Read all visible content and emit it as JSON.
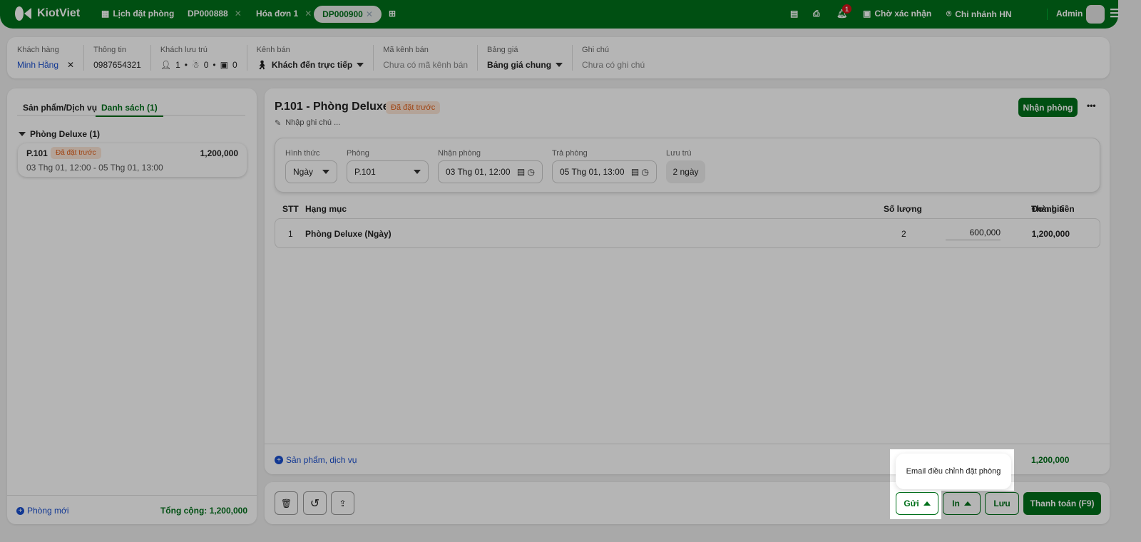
{
  "header": {
    "brand": "KiotViet",
    "nav_calendar": "Lịch đặt phòng",
    "tabs": [
      {
        "label": "DP000888"
      },
      {
        "label": "Hóa đơn 1"
      },
      {
        "label": "DP000900"
      }
    ],
    "notification_count": "1",
    "pending": "Chờ xác nhận",
    "branch": "Chi nhánh HN",
    "user": "Admin"
  },
  "customer_bar": {
    "customer_label": "Khách hàng",
    "customer": "Minh Hằng",
    "info_label": "Thông tin",
    "phone": "0987654321",
    "guests_label": "Khách lưu trú",
    "adults": "1",
    "children": "0",
    "ids": "0",
    "channel_label": "Kênh bán",
    "channel": "Khách đến trực tiếp",
    "channel_code_label": "Mã kênh bán",
    "channel_code_placeholder": "Chưa có mã kênh bán",
    "pricebook_label": "Bảng giá",
    "pricebook": "Bảng giá chung",
    "note_label": "Ghi chú",
    "note_placeholder": "Chưa có ghi chú"
  },
  "left": {
    "tabs": [
      "Sản phẩm/Dịch vụ",
      "Danh sách (1)"
    ],
    "group": "Phòng Deluxe (1)",
    "room": {
      "name": "P.101",
      "status": "Đã đặt trước",
      "price": "1,200,000",
      "dates": "03 Thg 01, 12:00 - 05 Thg 01, 13:00"
    },
    "new_room": "Phòng mới",
    "total": "Tổng cộng: 1,200,000"
  },
  "main": {
    "title": "P.101 - Phòng Deluxe",
    "status": "Đã đặt trước",
    "note_placeholder": "Nhập ghi chú ...",
    "checkin_button": "Nhận phòng",
    "form": {
      "type_label": "Hình thức",
      "type": "Ngày",
      "room_label": "Phòng",
      "room": "P.101",
      "checkin_label": "Nhận phòng",
      "checkin": "03 Thg 01, 12:00",
      "checkout_label": "Trả phòng",
      "checkout": "05 Thg 01, 13:00",
      "stay_label": "Lưu trú",
      "stay": "2 ngày"
    },
    "table": {
      "headers": [
        "STT",
        "Hạng mục",
        "Số lượng",
        "Đơn giá",
        "Thành tiền"
      ],
      "rows": [
        {
          "stt": "1",
          "item": "Phòng Deluxe (Ngày)",
          "qty": "2",
          "price": "600,000",
          "total": "1,200,000"
        }
      ]
    },
    "add_service": "Sản phẩm, dịch vụ",
    "subtotal": "1,200,000"
  },
  "footer": {
    "send": "Gửi",
    "print": "In",
    "save": "Lưu",
    "pay": "Thanh toán (F9)",
    "send_menu": [
      "Email điều chỉnh đặt phòng"
    ]
  }
}
